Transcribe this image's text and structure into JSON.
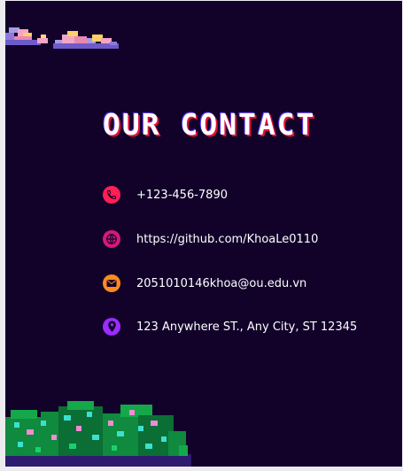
{
  "title": "OUR CONTACT",
  "contacts": [
    {
      "icon": "phone-icon",
      "text": "+123-456-7890",
      "color": "#ff1f55"
    },
    {
      "icon": "globe-icon",
      "text": "https://github.com/KhoaLe0110",
      "color": "#d6187a"
    },
    {
      "icon": "mail-icon",
      "text": "2051010146khoa@ou.edu.vn",
      "color": "#ff8a1f"
    },
    {
      "icon": "location-pin-icon",
      "text": "123 Anywhere ST., Any City, ST 12345",
      "color": "#9b2cff"
    }
  ]
}
